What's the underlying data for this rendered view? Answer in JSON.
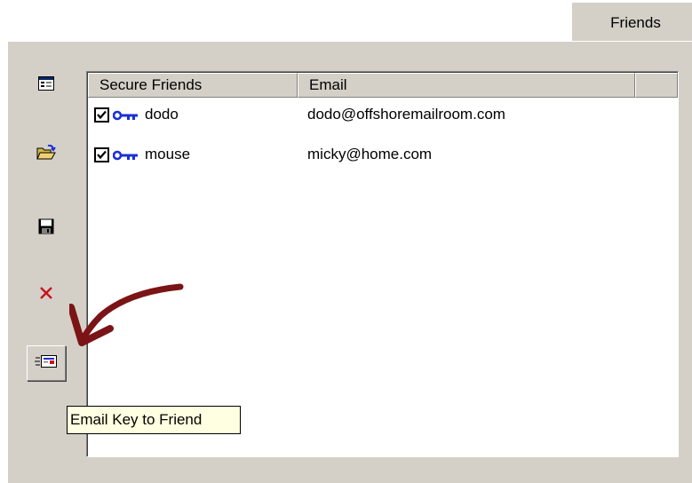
{
  "tab": {
    "label": "Friends"
  },
  "toolbar": {
    "buttons": [
      {
        "name": "properties-icon"
      },
      {
        "name": "open-folder-icon"
      },
      {
        "name": "save-icon"
      },
      {
        "name": "delete-icon"
      },
      {
        "name": "email-key-icon"
      }
    ]
  },
  "list": {
    "columns": [
      "Secure Friends",
      "Email"
    ],
    "rows": [
      {
        "name": "dodo",
        "email": "dodo@offshoremailroom.com",
        "checked": true
      },
      {
        "name": "mouse",
        "email": "micky@home.com",
        "checked": true
      }
    ]
  },
  "tooltip": {
    "text": "Email Key to Friend"
  },
  "colors": {
    "panel": "#d4d0c8",
    "arrow": "#7b1416",
    "key": "#1a2fd6",
    "tooltip_bg": "#ffffe1"
  }
}
